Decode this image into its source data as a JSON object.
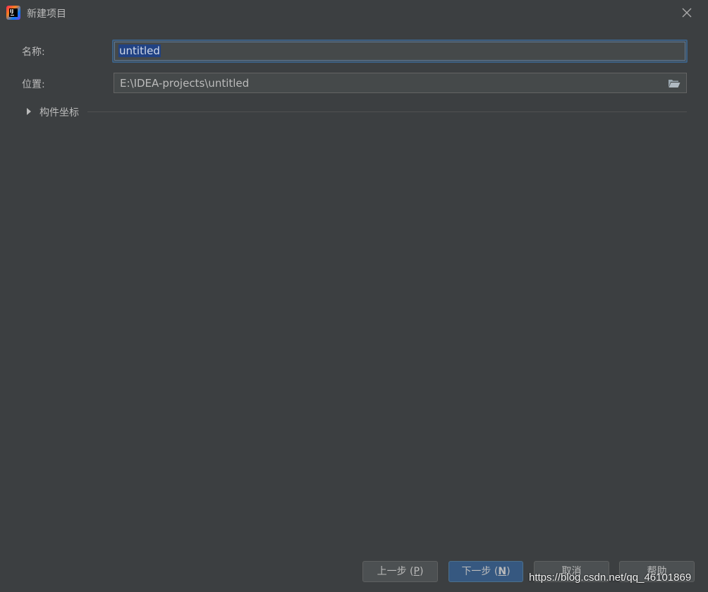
{
  "window": {
    "title": "新建项目",
    "app_icon": "intellij-idea-icon"
  },
  "form": {
    "name_label": "名称:",
    "name_value": "untitled",
    "location_label": "位置:",
    "location_value": "E:\\IDEA-projects\\untitled",
    "artifact_section_label": "构件坐标"
  },
  "buttons": {
    "prev_label": "上一步 (",
    "prev_mnemonic": "P",
    "prev_suffix": ")",
    "next_label": "下一步 (",
    "next_mnemonic": "N",
    "next_suffix": ")",
    "cancel_label": "取消",
    "help_label": "帮助"
  },
  "watermark": "https://blog.csdn.net/qq_46101869",
  "colors": {
    "background": "#3c3f41",
    "field_background": "#45494a",
    "focus_border": "#3d6185",
    "selection": "#214283",
    "primary_button": "#365880",
    "text": "#bbbbbb"
  }
}
